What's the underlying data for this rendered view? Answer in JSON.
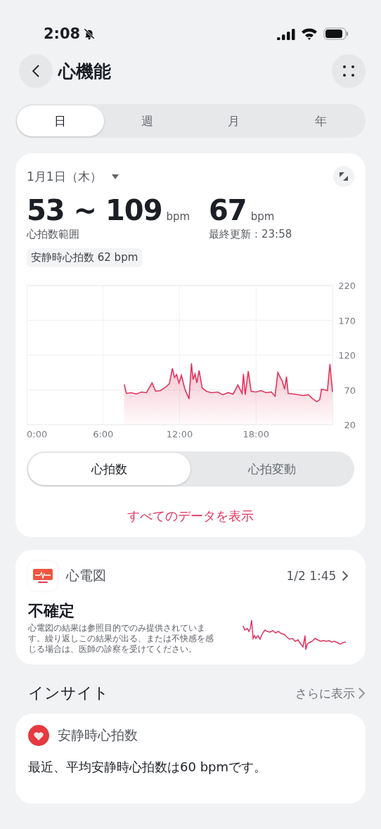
{
  "status_bar": {
    "time": "2:08"
  },
  "header": {
    "title": "心機能"
  },
  "period_tabs": [
    {
      "label": "日",
      "selected": true
    },
    {
      "label": "週",
      "selected": false
    },
    {
      "label": "月",
      "selected": false
    },
    {
      "label": "年",
      "selected": false
    }
  ],
  "summary_card": {
    "date": "1月1日（木）",
    "range": {
      "value": "53 ~ 109",
      "unit": "bpm",
      "label": "心拍数範囲"
    },
    "latest": {
      "value": "67",
      "unit": "bpm",
      "label": "最終更新：23:58"
    },
    "resting_badge": "安静時心拍数 62 bpm",
    "chart_data": {
      "type": "area",
      "x": [
        7.65,
        7.83,
        8.2,
        8.6,
        9.0,
        9.4,
        9.84,
        10.12,
        10.5,
        10.9,
        11.2,
        11.43,
        11.6,
        11.77,
        11.95,
        12.14,
        12.4,
        12.74,
        12.93,
        13.05,
        13.21,
        13.35,
        13.53,
        13.77,
        14.1,
        14.5,
        14.99,
        15.4,
        15.8,
        16.2,
        16.58,
        16.9,
        17.01,
        17.15,
        17.39,
        17.61,
        18.0,
        18.4,
        18.8,
        19.2,
        19.49,
        19.71,
        19.9,
        20.05,
        20.24,
        20.39,
        20.52,
        21.0,
        21.36,
        21.7,
        22.11,
        22.4,
        22.77,
        23.0,
        23.14,
        23.4,
        23.6,
        23.8,
        24.0
      ],
      "grid": true,
      "series": [
        {
          "color": "#e0355e",
          "values": [
            78,
            65,
            66,
            64,
            67,
            66,
            80,
            68,
            69,
            74,
            79,
            101,
            88,
            92,
            80,
            91,
            72,
            57,
            108,
            85,
            93,
            80,
            98,
            73,
            68,
            66,
            67,
            63,
            66,
            64,
            77,
            65,
            93,
            63,
            97,
            68,
            67,
            69,
            66,
            67,
            61,
            95,
            88,
            83,
            71,
            89,
            65,
            64,
            63,
            62,
            63,
            58,
            53,
            56,
            71,
            70,
            69,
            107,
            67
          ]
        }
      ],
      "xlim": [
        0,
        24
      ],
      "ylim": [
        20,
        220
      ],
      "xticks": [
        {
          "value": 0,
          "label": "0:00"
        },
        {
          "value": 6,
          "label": "6:00"
        },
        {
          "value": 12,
          "label": "12:00"
        },
        {
          "value": 18,
          "label": "18:00"
        }
      ],
      "yticks": [
        20,
        70,
        120,
        170,
        220
      ]
    },
    "metric_tabs": [
      {
        "label": "心拍数",
        "selected": true
      },
      {
        "label": "心拍変動",
        "selected": false
      }
    ],
    "link": "すべてのデータを表示"
  },
  "ecg_card": {
    "title": "心電図",
    "timestamp": "1/2 1:45",
    "result": "不確定",
    "description": "心電図の結果は参照目的でのみ提供されています。繰り返しこの結果が出る、または不快感を感じる場合は、医師の診察を受けてください。"
  },
  "insights": {
    "title": "インサイト",
    "more": "さらに表示",
    "cards": [
      {
        "title": "安静時心拍数",
        "text": "最近、平均安静時心拍数は60 bpmです。"
      }
    ]
  }
}
